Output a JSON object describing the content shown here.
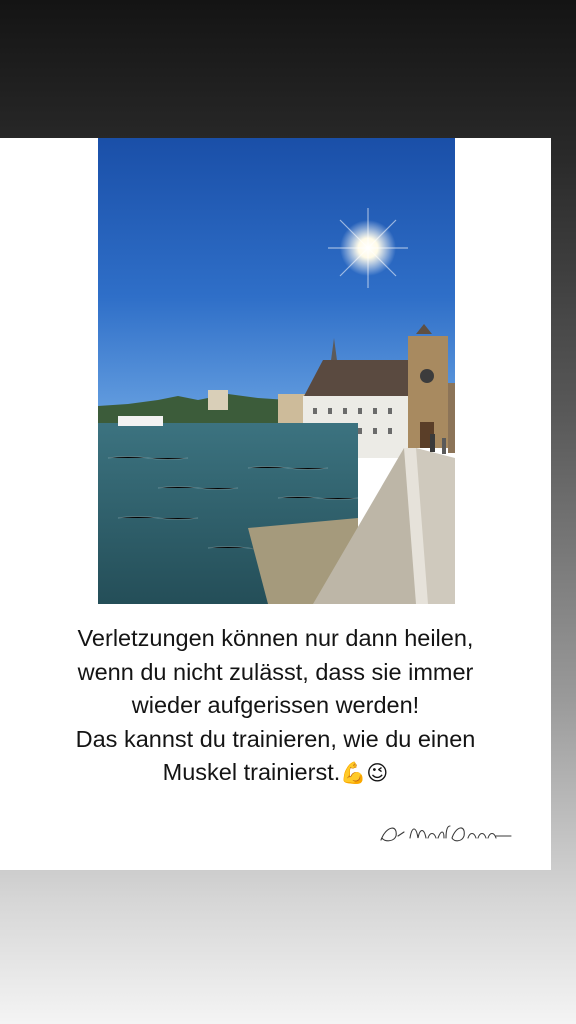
{
  "caption": {
    "lines": [
      "Verletzungen können nur dann heilen,",
      "wenn du nicht zulässt, dass sie immer",
      "wieder aufgerissen werden!",
      "Das kannst du trainieren, wie du einen",
      "Muskel trainierst."
    ],
    "emoji_muscle": "💪",
    "emoji_wink": "😉"
  },
  "signature": {
    "text": "Dr. Norbert Dannerbauer"
  },
  "colors": {
    "sky_top": "#1e56b0",
    "sky_bottom": "#5d9ae0",
    "water": "#2f6470",
    "building": "#ecebe6",
    "roof": "#5a4a40",
    "tower": "#a88a60"
  }
}
